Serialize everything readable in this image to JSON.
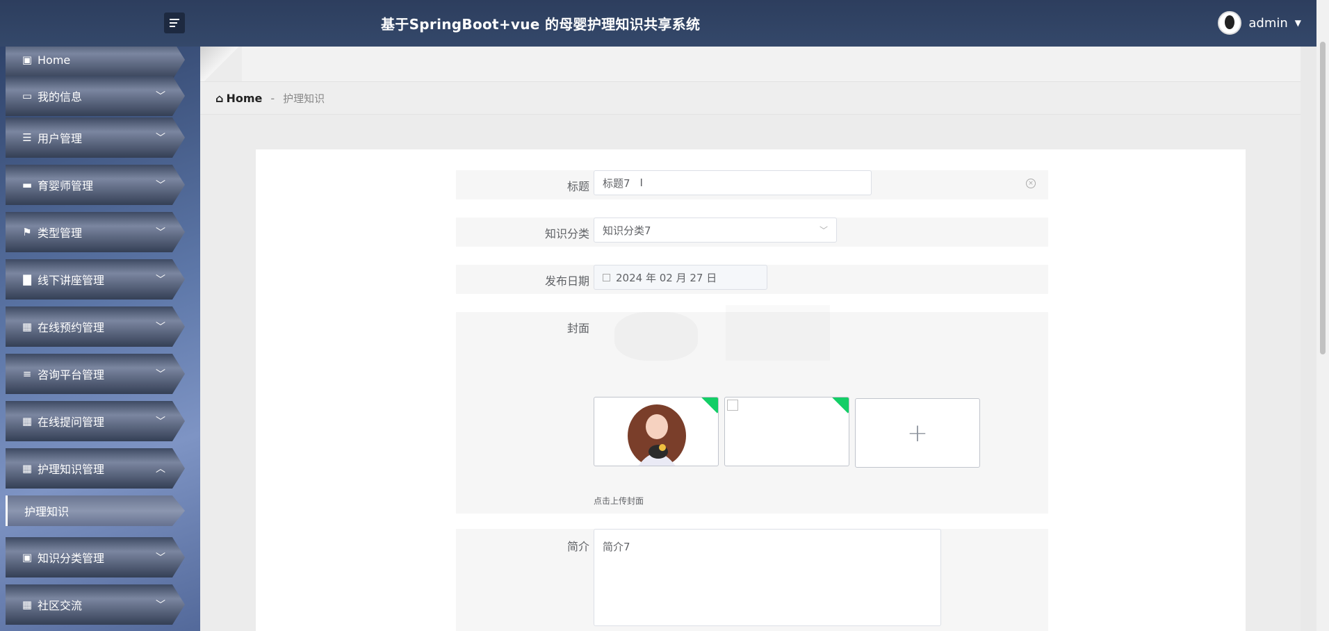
{
  "header": {
    "title": "基于SpringBoot+vue 的母婴护理知识共享系统",
    "username": "admin"
  },
  "sidebar": {
    "items": [
      {
        "label": "Home",
        "icon": "home-icon"
      },
      {
        "label": "我的信息",
        "icon": "card-icon"
      },
      {
        "label": "用户管理",
        "icon": "list-icon"
      },
      {
        "label": "育婴师管理",
        "icon": "chat-icon"
      },
      {
        "label": "类型管理",
        "icon": "flag-icon"
      },
      {
        "label": "线下讲座管理",
        "icon": "briefcase-icon"
      },
      {
        "label": "在线预约管理",
        "icon": "grid-icon"
      },
      {
        "label": "咨询平台管理",
        "icon": "sliders-icon"
      },
      {
        "label": "在线提问管理",
        "icon": "grid-icon"
      },
      {
        "label": "护理知识管理",
        "icon": "grid-icon"
      },
      {
        "label": "护理知识",
        "icon": ""
      },
      {
        "label": "知识分类管理",
        "icon": "wallet-icon"
      },
      {
        "label": "社区交流",
        "icon": "grid-icon"
      }
    ]
  },
  "breadcrumb": {
    "home": "Home",
    "separator": "-",
    "current": "护理知识"
  },
  "form": {
    "title_label": "标题",
    "title_value": "标题7",
    "category_label": "知识分类",
    "category_value": "知识分类7",
    "date_label": "发布日期",
    "date_value": "2024 年 02 月 27 日",
    "cover_label": "封面",
    "cover_hint": "点击上传封面",
    "upload_plus": "+",
    "intro_label": "简介",
    "intro_value": "简介7"
  },
  "colors": {
    "header_bg": "#2d3e5e",
    "success_tag": "#13ce66"
  }
}
